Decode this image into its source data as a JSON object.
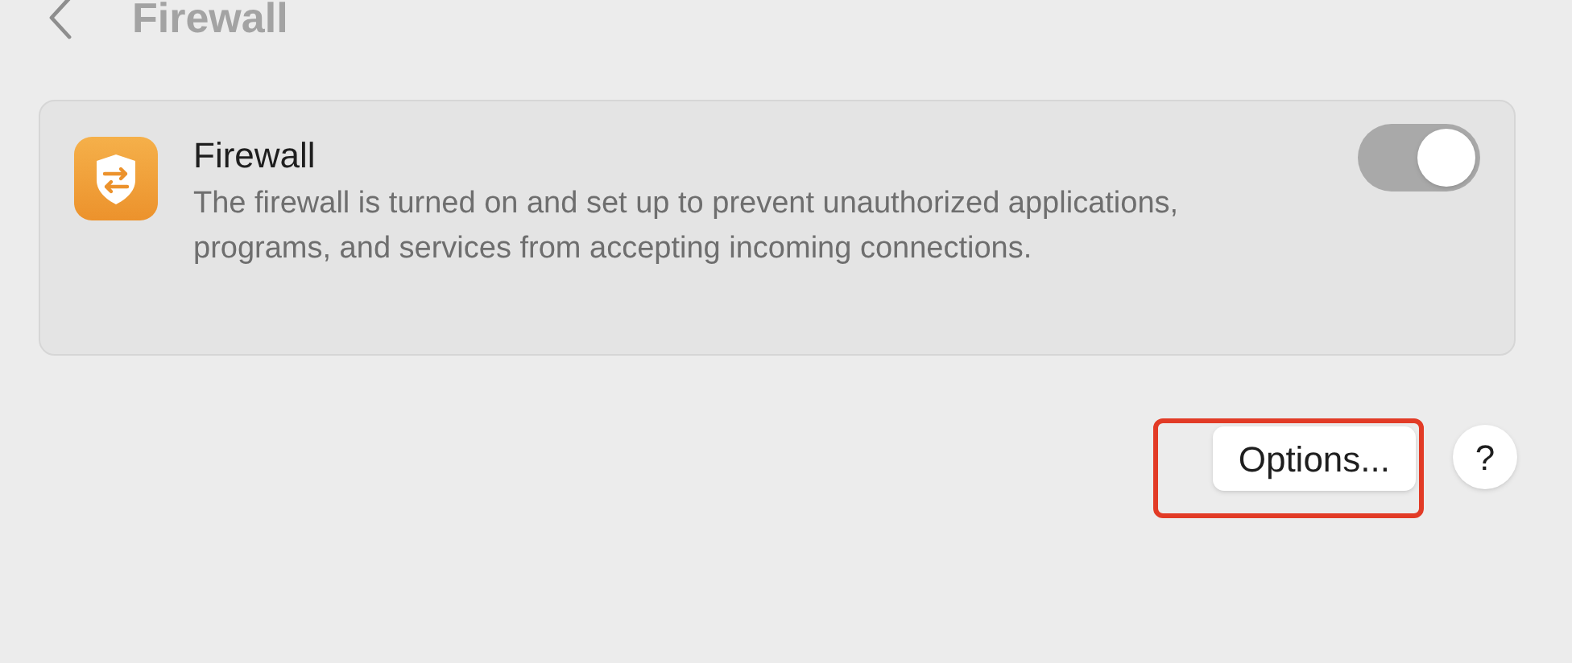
{
  "header": {
    "title": "Firewall"
  },
  "firewall": {
    "title": "Firewall",
    "description": "The firewall is turned on and set up to prevent unauthorized applications, programs, and services from accepting incoming connections.",
    "on": true
  },
  "options_button": {
    "label": "Options...",
    "highlighted": true
  },
  "help_button": {
    "label": "?"
  }
}
